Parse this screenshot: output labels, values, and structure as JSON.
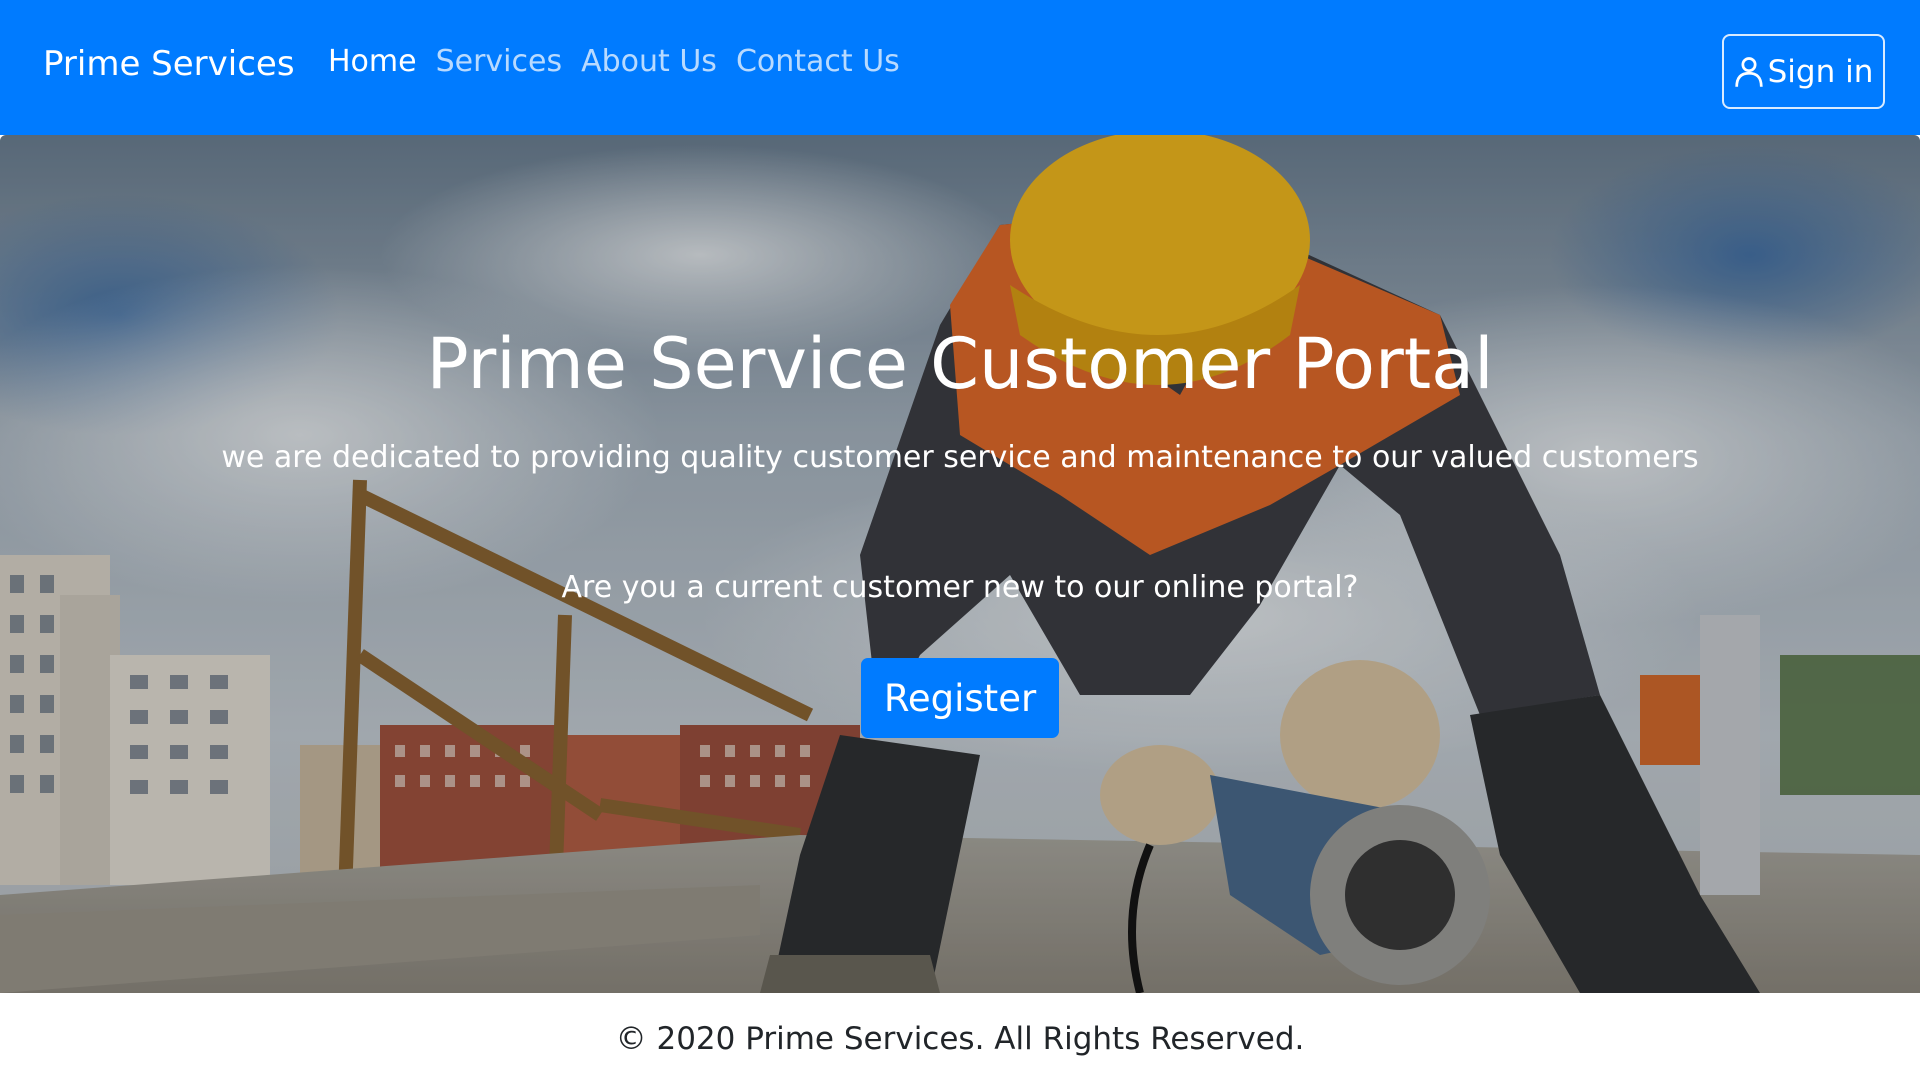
{
  "navbar": {
    "brand": "Prime Services",
    "links": [
      {
        "label": "Home",
        "active": true
      },
      {
        "label": "Services",
        "active": false
      },
      {
        "label": "About Us",
        "active": false
      },
      {
        "label": "Contact Us",
        "active": false
      }
    ],
    "sign_in_label": "Sign in",
    "sign_in_icon": "person-icon",
    "color": "#007bff"
  },
  "hero": {
    "title": "Prime Service Customer Portal",
    "subtitle": "we are dedicated to providing quality customer service and maintenance to our valued customers",
    "question": "Are you a current customer new to our online portal?",
    "register_label": "Register",
    "background_image": "construction-worker-with-angle-grinder"
  },
  "footer": {
    "text": "© 2020 Prime Services. All Rights Reserved."
  }
}
